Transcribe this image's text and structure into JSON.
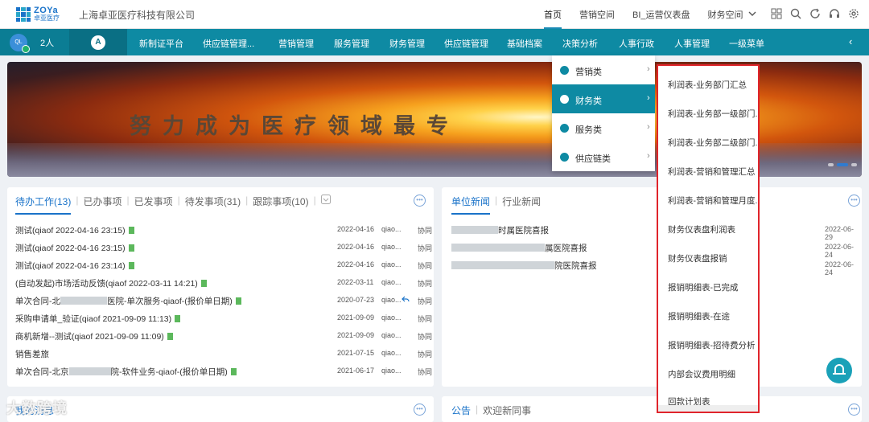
{
  "header": {
    "logo_en": "ZOYa",
    "logo_cn": "卓亚医疗",
    "company": "上海卓亚医疗科技有限公司",
    "nav": [
      "首页",
      "营销空间",
      "BI_运营仪表盘",
      "财务空间"
    ]
  },
  "mainnav": {
    "user_initials": "QL",
    "people_count": "2人",
    "home_letter": "A",
    "items": [
      "新制证平台",
      "供应链管理...",
      "营销管理",
      "服务管理",
      "财务管理",
      "供应链管理",
      "基础档案",
      "决策分析",
      "人事行政",
      "人事管理",
      "一级菜单"
    ],
    "back": "‹"
  },
  "banner": {
    "slogan": "努力成为医疗领域最专"
  },
  "todo": {
    "tabs": [
      "待办工作(13)",
      "已办事项",
      "已发事项",
      "待发事项(31)",
      "跟踪事项(10)"
    ],
    "rows": [
      {
        "title": "测试(qiaof 2022-04-16 23:15)",
        "date": "2022-04-16",
        "user": "qiao...",
        "status": "协同"
      },
      {
        "title": "测试(qiaof 2022-04-16 23:15)",
        "date": "2022-04-16",
        "user": "qiao...",
        "status": "协同"
      },
      {
        "title": "测试(qiaof 2022-04-16 23:14)",
        "date": "2022-04-16",
        "user": "qiao...",
        "status": "协同"
      },
      {
        "title": "(自动发起)市场活动反馈(qiaof 2022-03-11 14:21)",
        "date": "2022-03-11",
        "user": "qiao...",
        "status": "协同"
      },
      {
        "title_a": "单次合同-北",
        "title_b": "医院-单次服务-qiaof-(报价单日期)",
        "date": "2020-07-23",
        "user": "qiao...",
        "status": "协同"
      },
      {
        "title": "采购申请单_验证(qiaof 2021-09-09 11:13)",
        "date": "2021-09-09",
        "user": "qiao...",
        "status": "协同"
      },
      {
        "title": "商机新增--测试(qiaof 2021-09-09 11:09)",
        "date": "2021-09-09",
        "user": "qiao...",
        "status": "协同"
      },
      {
        "title": "销售差旅",
        "date": "2021-07-15",
        "user": "qiao...",
        "status": "协同"
      },
      {
        "title_a": "单次合同-北京",
        "title_b": "院-软件业务-qiaof-(报价单日期)",
        "date": "2021-06-17",
        "user": "qiao...",
        "status": "协同"
      }
    ]
  },
  "news": {
    "tabs": [
      "单位新闻",
      "行业新闻"
    ],
    "rows": [
      {
        "title": "时属医院喜报",
        "date": "2022-06-29"
      },
      {
        "title": "属医院喜报",
        "date": "2022-06-24"
      },
      {
        "title": "院医院喜报",
        "date": "2022-06-24"
      }
    ]
  },
  "bottom": {
    "left_tab": "我的消息",
    "right_tabs": [
      "公告",
      "欢迎新同事"
    ]
  },
  "flyout": {
    "items": [
      "营销类",
      "财务类",
      "服务类",
      "供应链类"
    ],
    "selected": "财务类"
  },
  "submenu": {
    "items": [
      "利润表-业务部门汇总",
      "利润表-业务部一级部门...",
      "利润表-业务部二级部门...",
      "利润表-营销和管理汇总",
      "利润表-营销和管理月度...",
      "财务仪表盘利润表",
      "财务仪表盘报销",
      "报销明细表-已完成",
      "报销明细表-在途",
      "报销明细表-招待费分析",
      "内部会议费用明细",
      "回款计划表"
    ]
  },
  "watermark": "大数跨境"
}
